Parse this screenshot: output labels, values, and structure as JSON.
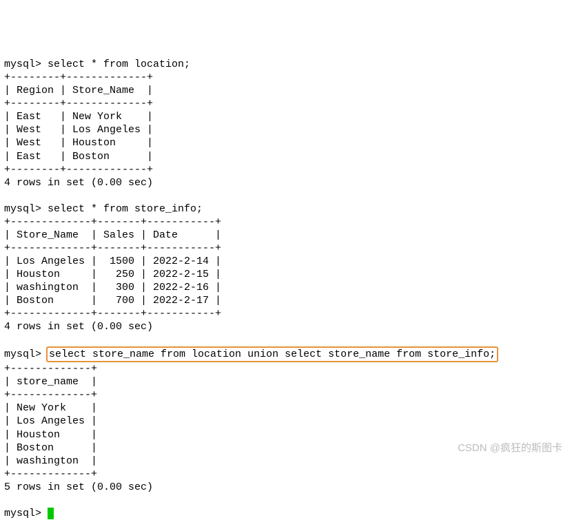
{
  "prompts": {
    "mysql": "mysql> "
  },
  "queries": {
    "q1": "select * from location;",
    "q2": "select * from store_info;",
    "q3": "select store_name from location union select store_name from store_info;"
  },
  "table1": {
    "border_top": "+--------+-------------+",
    "header": "| Region | Store_Name  |",
    "border_mid": "+--------+-------------+",
    "rows": [
      "| East   | New York    |",
      "| West   | Los Angeles |",
      "| West   | Houston     |",
      "| East   | Boston      |"
    ],
    "border_bot": "+--------+-------------+",
    "footer": "4 rows in set (0.00 sec)"
  },
  "table2": {
    "border_top": "+-------------+-------+-----------+",
    "header": "| Store_Name  | Sales | Date      |",
    "border_mid": "+-------------+-------+-----------+",
    "rows": [
      "| Los Angeles |  1500 | 2022-2-14 |",
      "| Houston     |   250 | 2022-2-15 |",
      "| washington  |   300 | 2022-2-16 |",
      "| Boston      |   700 | 2022-2-17 |"
    ],
    "border_bot": "+-------------+-------+-----------+",
    "footer": "4 rows in set (0.00 sec)"
  },
  "table3": {
    "border_top": "+-------------+",
    "header": "| store_name  |",
    "border_mid": "+-------------+",
    "rows": [
      "| New York    |",
      "| Los Angeles |",
      "| Houston     |",
      "| Boston      |",
      "| washington  |"
    ],
    "border_bot": "+-------------+",
    "footer": "5 rows in set (0.00 sec)"
  },
  "watermark": "CSDN @疯狂的斯图卡"
}
